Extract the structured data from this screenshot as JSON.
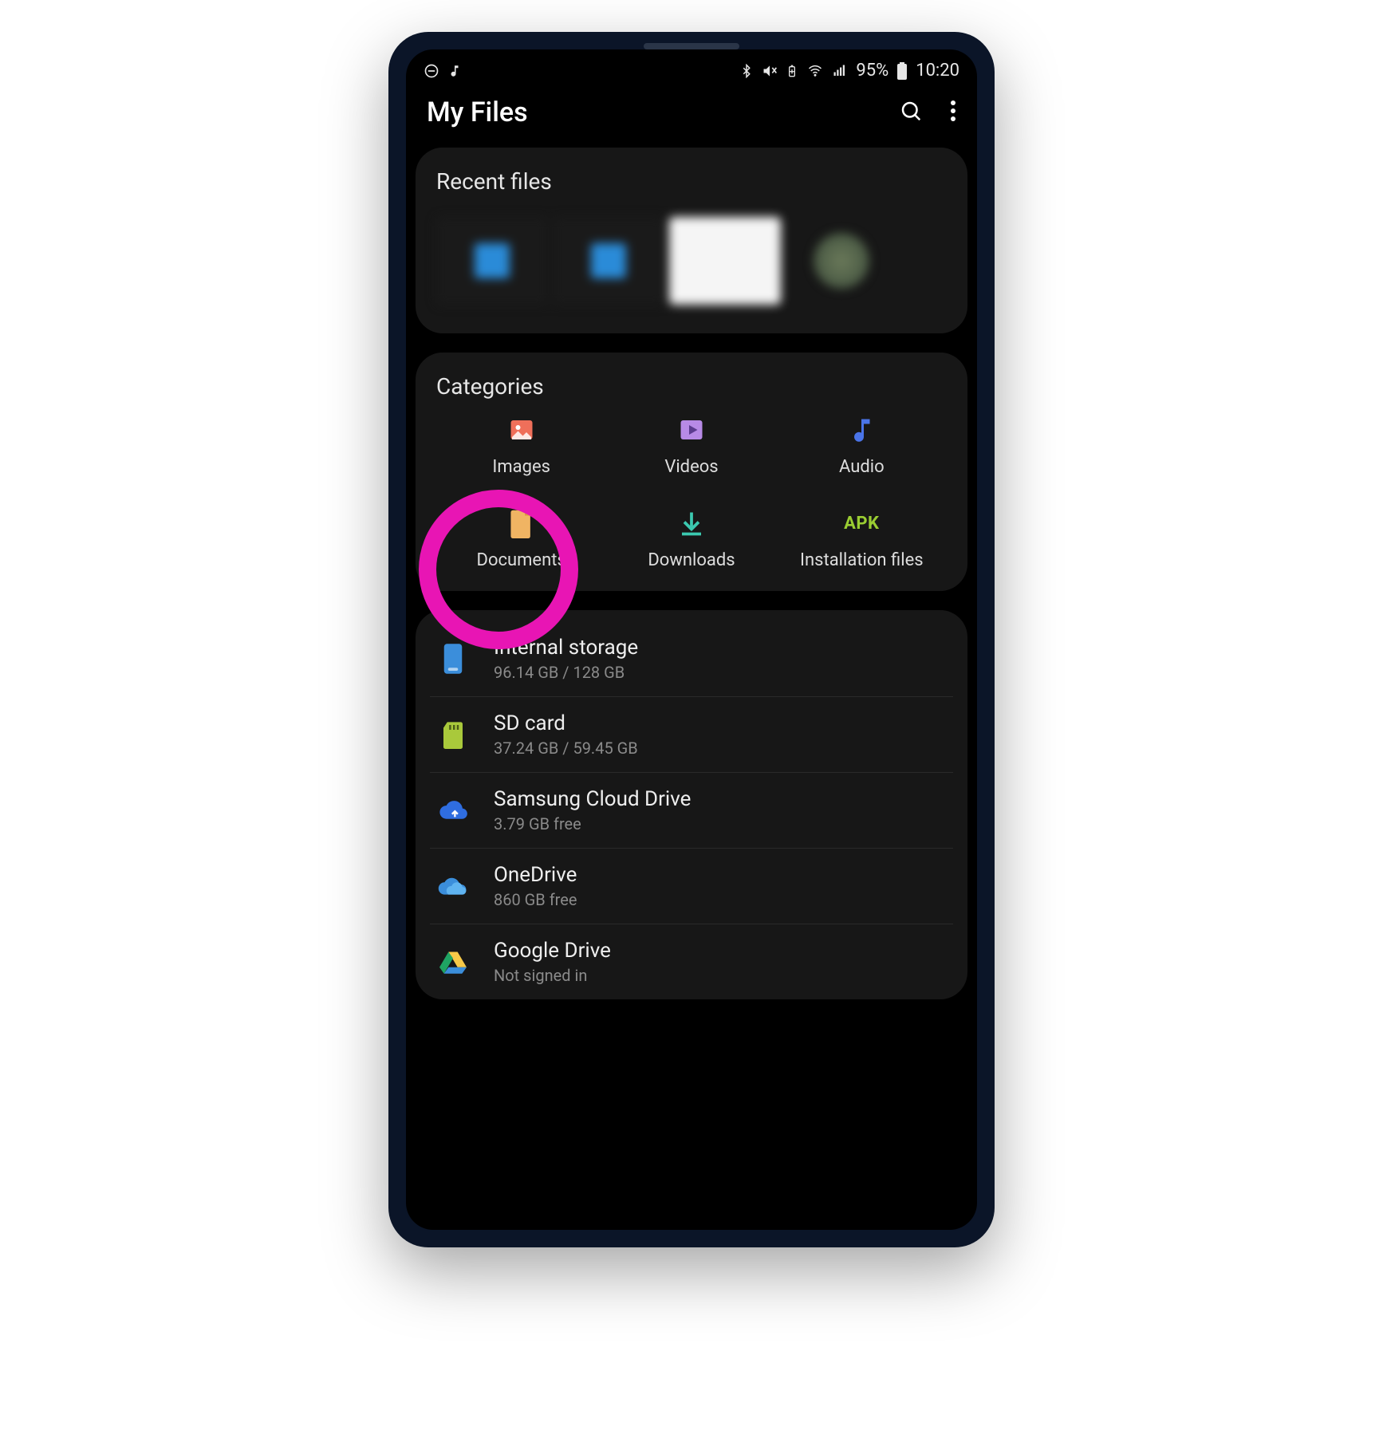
{
  "status": {
    "battery_pct": "95%",
    "time": "10:20"
  },
  "app": {
    "title": "My Files"
  },
  "recent": {
    "title": "Recent files"
  },
  "categories": {
    "title": "Categories",
    "items": [
      {
        "label": "Images"
      },
      {
        "label": "Videos"
      },
      {
        "label": "Audio"
      },
      {
        "label": "Documents"
      },
      {
        "label": "Downloads"
      },
      {
        "label": "Installation files",
        "apk": "APK"
      }
    ]
  },
  "storage": [
    {
      "title": "Internal storage",
      "sub": "96.14 GB / 128 GB"
    },
    {
      "title": "SD card",
      "sub": "37.24 GB / 59.45 GB"
    },
    {
      "title": "Samsung Cloud Drive",
      "sub": "3.79 GB free"
    },
    {
      "title": "OneDrive",
      "sub": "860 GB free"
    },
    {
      "title": "Google Drive",
      "sub": "Not signed in"
    }
  ]
}
